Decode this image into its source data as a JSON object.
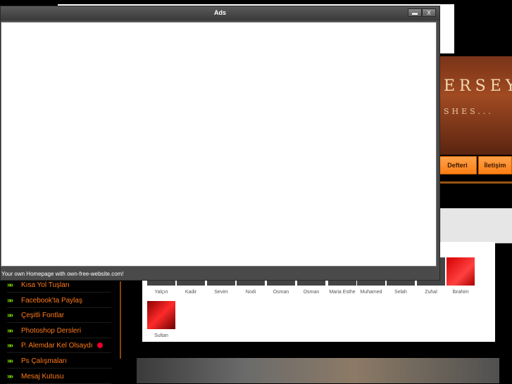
{
  "ads_window": {
    "title": "Ads",
    "footer": "Your own Homepage with own-free-website.com!",
    "minimize_label": "",
    "close_label": "X"
  },
  "banner": {
    "title": "ERSEY",
    "subtitle": "SHES..."
  },
  "nav": {
    "items": [
      "Defteri",
      "İletişim"
    ]
  },
  "members": {
    "names": [
      "Yalçın",
      "Kadir",
      "Sevim",
      "Nodi",
      "Osman",
      "Osman",
      "Maria Esthe",
      "Muhamed",
      "Selah",
      "Zuhal",
      "İbrahim",
      "Sultan"
    ]
  },
  "sidebar": {
    "items": [
      "Kısa Yol Tuşları",
      "Facebook'ta Paylaş",
      "Çeşitli Fontlar",
      "Photoshop Dersleri",
      "P. Alemdar Kel Olsaydı",
      "Ps Çalışmaları",
      "Mesaj Kutusu"
    ]
  },
  "colors": {
    "accent_orange": "#ff7a1a",
    "arrow_green": "#7cd400"
  }
}
